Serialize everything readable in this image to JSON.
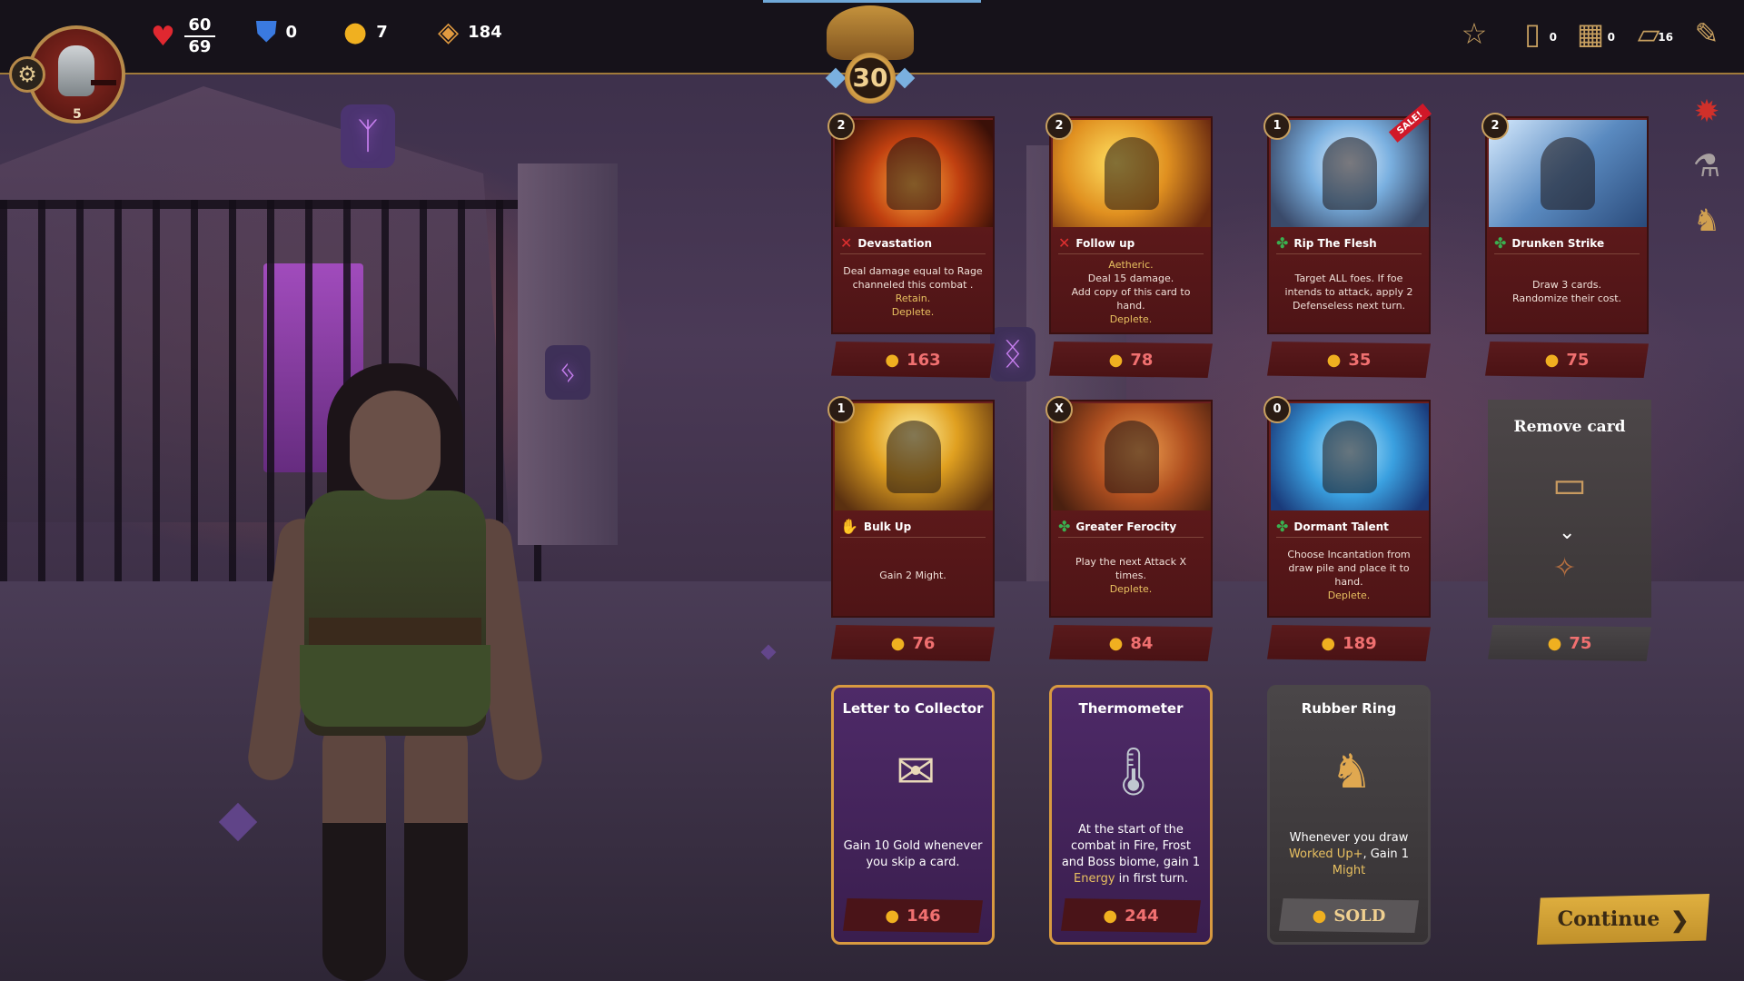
{
  "player": {
    "level": "5",
    "health_current": "60",
    "health_max": "69",
    "shield": "0",
    "gold": "7",
    "gems": "184",
    "act_level": "30"
  },
  "top_right": {
    "buttons": [
      {
        "icon": "star-map-icon",
        "badge": ""
      },
      {
        "icon": "draw-pile-icon",
        "badge": "0"
      },
      {
        "icon": "discard-pile-icon",
        "badge": "0"
      },
      {
        "icon": "deck-icon",
        "badge": "16"
      },
      {
        "icon": "quill-icon",
        "badge": ""
      }
    ]
  },
  "side_icons": [
    "flame-relic-icon",
    "potion-relic-icon",
    "strongman-relic-icon"
  ],
  "cards": [
    {
      "cost": "2",
      "title": "Devastation",
      "type": "attack",
      "art": "art-devastation",
      "desc": [
        "Deal damage equal to Rage channeled this combat .",
        "Retain.",
        "Deplete."
      ],
      "price": "163",
      "sale": ""
    },
    {
      "cost": "2",
      "title": "Follow up",
      "type": "attack",
      "art": "art-followup",
      "desc": [
        "Aetheric.",
        "Deal 15 damage.",
        "Add copy of this card to hand.",
        "Deplete."
      ],
      "price": "78",
      "sale": ""
    },
    {
      "cost": "1",
      "title": "Rip The Flesh",
      "type": "skill",
      "art": "art-rip",
      "desc": [
        "Target ALL foes. If foe intends to attack, apply 2 Defenseless next turn."
      ],
      "price": "35",
      "sale": "SALE!"
    },
    {
      "cost": "2",
      "title": "Drunken Strike",
      "type": "skill",
      "art": "art-drunken",
      "desc": [
        "Draw 3 cards.",
        "Randomize their cost."
      ],
      "price": "75",
      "sale": ""
    },
    {
      "cost": "1",
      "title": "Bulk Up",
      "type": "power",
      "art": "art-bulk",
      "desc": [
        "Gain 2 Might."
      ],
      "price": "76",
      "sale": ""
    },
    {
      "cost": "X",
      "title": "Greater Ferocity",
      "type": "skill",
      "art": "art-ferocity",
      "desc": [
        "Play the next Attack X times.",
        "Deplete."
      ],
      "price": "84",
      "sale": ""
    },
    {
      "cost": "0",
      "title": "Dormant Talent",
      "type": "skill",
      "art": "art-dormant",
      "desc": [
        "Choose Incantation from draw pile and place it to hand.",
        "Deplete."
      ],
      "price": "189",
      "sale": ""
    }
  ],
  "remove_card": {
    "title": "Remove card",
    "price": "75"
  },
  "relics": [
    {
      "title": "Letter to Collector",
      "icon": "sealed-letter-icon",
      "desc": "Gain 10 Gold whenever you skip a card.",
      "price": "146",
      "sold": false
    },
    {
      "title": "Thermometer",
      "icon": "thermometer-icon",
      "desc_parts": [
        "At the start of the combat in Fire, Frost and Boss biome, gain 1 ",
        "Energy",
        " in first turn."
      ],
      "price": "244",
      "sold": false
    },
    {
      "title": "Rubber Ring",
      "icon": "strongman-icon",
      "desc_parts": [
        "Whenever you draw ",
        "Worked Up+",
        ", Gain 1 ",
        "Might"
      ],
      "price": "SOLD",
      "sold": true
    }
  ],
  "continue_label": "Continue",
  "colors": {
    "accent_gold": "#d89a40",
    "price_red": "#f07070",
    "card_red": "#6a1e1e",
    "relic_purple": "#4e2a68"
  }
}
